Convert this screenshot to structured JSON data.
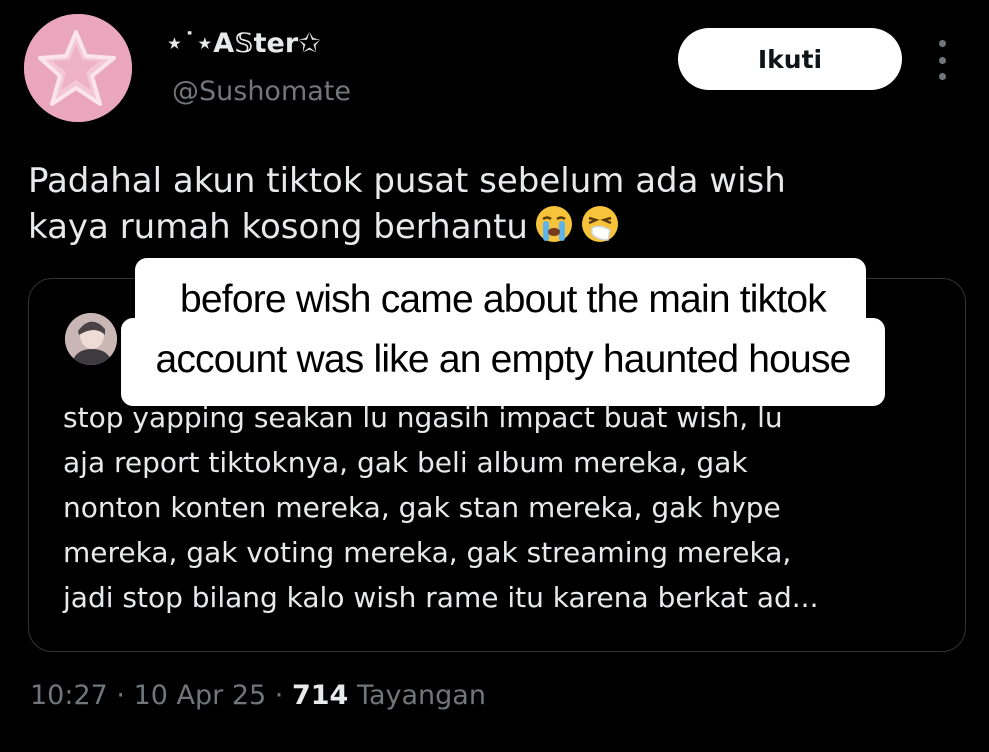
{
  "author": {
    "display_name": "⋆˙⋆A𝕊ter✩",
    "handle": "@Sushomate"
  },
  "follow_button": {
    "label": "Ikuti"
  },
  "tweet": {
    "lines": [
      "Padahal akun tiktok pusat sebelum ada wish",
      "kaya rumah kosong berhantu"
    ],
    "emojis": [
      "loudly-crying-face",
      "sneezing-face"
    ]
  },
  "quoted_tweet": {
    "lines": [
      "stop yapping seakan lu ngasih impact buat wish, lu",
      "aja report tiktoknya, gak beli album mereka, gak",
      "nonton konten mereka, gak stan mereka, gak hype",
      "mereka, gak voting mereka, gak streaming mereka,",
      "jadi stop bilang kalo wish rame itu karena berkat ad..."
    ]
  },
  "meta": {
    "time": "10:27",
    "separator": "·",
    "date": "10 Apr 25",
    "views": "714",
    "views_label": "Tayangan"
  },
  "caption": {
    "lines": [
      "before wish came about the main tiktok",
      "account was like an empty haunted house"
    ]
  },
  "colors": {
    "background": "#000000",
    "text": "#e7e9ea",
    "muted": "#71767b",
    "border": "#2f3336",
    "avatar_pink": "#e9a6bd"
  }
}
